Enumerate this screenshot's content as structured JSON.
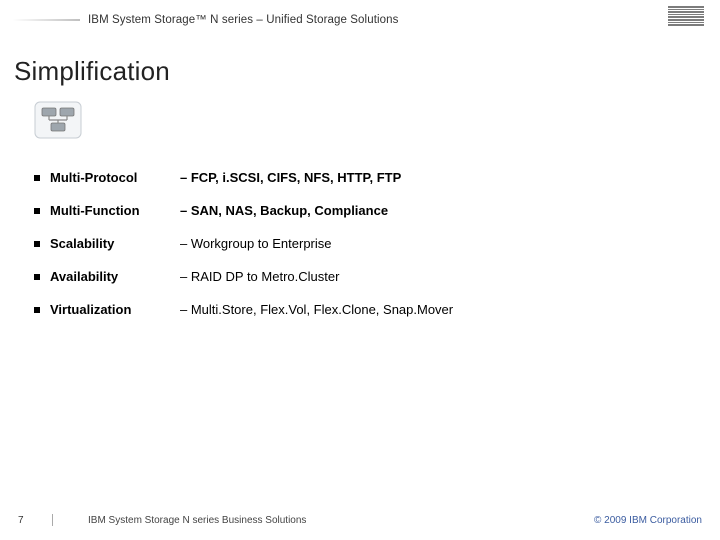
{
  "header": {
    "title": "IBM System Storage™ N series – Unified Storage Solutions",
    "logo_name": "ibm-logo"
  },
  "title": "Simplification",
  "icon_name": "storage-servers-icon",
  "bullets": [
    {
      "term": "Multi-Protocol",
      "desc": "– FCP, i.SCSI, CIFS, NFS, HTTP, FTP"
    },
    {
      "term": "Multi-Function",
      "desc": "– SAN, NAS, Backup, Compliance"
    },
    {
      "term": "Scalability",
      "desc": "– Workgroup to Enterprise"
    },
    {
      "term": "Availability",
      "desc": "– RAID DP to Metro.Cluster"
    },
    {
      "term": "Virtualization",
      "desc": "– Multi.Store, Flex.Vol, Flex.Clone, Snap.Mover"
    }
  ],
  "footer": {
    "page": "7",
    "title": "IBM System Storage N series Business Solutions",
    "copyright": "© 2009 IBM Corporation"
  }
}
